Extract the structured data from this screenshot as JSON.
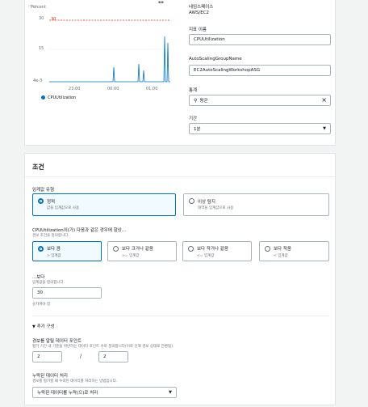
{
  "metric_panel": {
    "chart": {
      "ylabel": "Percent",
      "y_ticks": [
        "30",
        "15",
        "4e-3"
      ],
      "x_ticks": [
        "23:00",
        "00:00",
        "01:00"
      ],
      "threshold_label": "30",
      "legend": "CPUUtilization",
      "colors": {
        "series": "#0073bb",
        "threshold": "#d13212"
      }
    },
    "chart_data": {
      "type": "line",
      "ylabel": "Percent",
      "x": [
        "23:00",
        "00:00",
        "01:00"
      ],
      "series": [
        {
          "name": "CPUUtilization",
          "color": "#0073bb",
          "values": [
            0.004,
            0.004,
            0.004
          ]
        }
      ],
      "threshold": 30,
      "spikes": [
        {
          "x": "23:40",
          "y": 5
        },
        {
          "x": "00:20",
          "y": 6
        },
        {
          "x": "00:25",
          "y": 5
        },
        {
          "x": "00:50",
          "y": 18
        },
        {
          "x": "00:52",
          "y": 15
        }
      ]
    },
    "namespace_label": "네임스페이스",
    "namespace_value": "AWS/EC2",
    "metric_name_label": "지표 이름",
    "metric_name_value": "CPUUtilization",
    "asg_label": "AutoScalingGroupName",
    "asg_value": "EC2AutoScalingWorkshopASG",
    "stat_label": "통계",
    "stat_value": "평균",
    "period_label": "기간",
    "period_value": "1분"
  },
  "conditions": {
    "title": "조건",
    "threshold_type_label": "임계값 유형",
    "static_label": "정적",
    "static_desc": "값을 임계값으로 사용",
    "anomaly_label": "이상 탐지",
    "anomaly_desc": "대역을 임계값으로 사용",
    "compare_label": "CPUUtilization이(가) 다음과 같은 경우에 항상...",
    "compare_desc": "경보 조건을 정의합니다.",
    "options": [
      {
        "label": "보다 큼",
        "sub": "> 임계값"
      },
      {
        "label": "보다 크거나 같음",
        "sub": ">= 임계값"
      },
      {
        "label": "보다 작거나 같음",
        "sub": "<= 임계값"
      },
      {
        "label": "보다 작음",
        "sub": "< 임계값"
      }
    ],
    "than_label": "...보다",
    "than_desc": "임계값을 정의합니다.",
    "than_value": "30",
    "than_hint": "숫자여야 함",
    "extra_label": "추가 구성",
    "datapoints_label": "경보를 알릴 데이터 포인트",
    "datapoints_desc": "평가 기간 내 기준을 위반하는 데이터 포인트 수로 정의합니다(이로 인해 경보 상태로 전환됨).",
    "datapoints_n": "2",
    "datapoints_sep": "/",
    "datapoints_m": "2",
    "missing_label": "누락된 데이터 처리",
    "missing_desc": "경보를 평가할 때 누락된 데이터를 처리하는 방법입니다.",
    "missing_value": "누락된 데이터를 누락(으)로 처리"
  }
}
